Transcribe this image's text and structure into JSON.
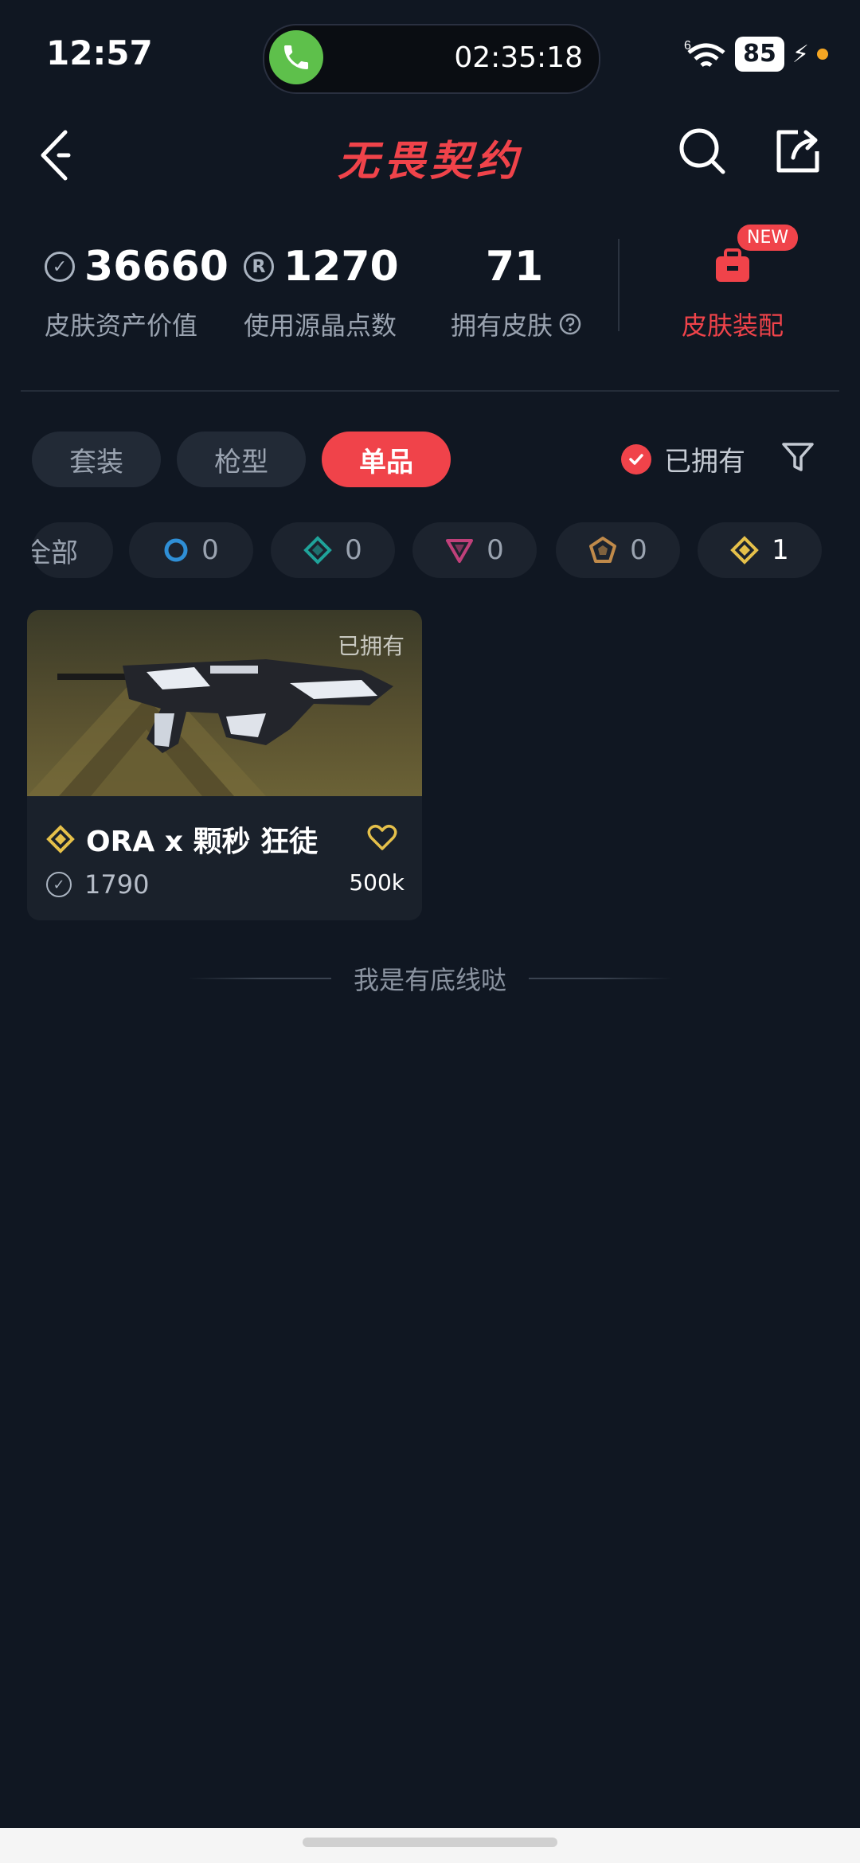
{
  "status_bar": {
    "time": "12:57",
    "call_timer": "02:35:18",
    "network": "6",
    "battery": "85"
  },
  "header": {
    "logo_text": "无畏契约",
    "back_icon": "chevron-left-icon",
    "search_icon": "search-icon",
    "share_icon": "share-icon"
  },
  "stats": {
    "asset_value": "36660",
    "asset_label": "皮肤资产价值",
    "points_value": "1270",
    "points_label": "使用源晶点数",
    "owned_value": "71",
    "owned_label": "拥有皮肤",
    "equip_label": "皮肤装配",
    "new_badge": "NEW"
  },
  "tabs": [
    {
      "label": "套装",
      "active": false
    },
    {
      "label": "枪型",
      "active": false
    },
    {
      "label": "单品",
      "active": true
    }
  ],
  "owned_filter_label": "已拥有",
  "rarity_chips": [
    {
      "label": "全部",
      "count": ""
    },
    {
      "icon": "circle-tier-icon",
      "count": "0",
      "color": "#2f8fd6"
    },
    {
      "icon": "diamond-tier-icon",
      "count": "0",
      "color": "#1fa39a"
    },
    {
      "icon": "triangle-tier-icon",
      "count": "0",
      "color": "#c0407a"
    },
    {
      "icon": "pentagon-tier-icon",
      "count": "0",
      "color": "#c08a4a"
    },
    {
      "icon": "diamond-gold-tier-icon",
      "count": "1",
      "color": "#e5c04a"
    }
  ],
  "items": [
    {
      "owned_tag": "已拥有",
      "name": "ORA x 颗秒 狂徒",
      "price": "1790",
      "likes": "500k"
    }
  ],
  "footer_text": "我是有底线哒",
  "colors": {
    "background": "#101722",
    "accent": "#f0434a"
  }
}
